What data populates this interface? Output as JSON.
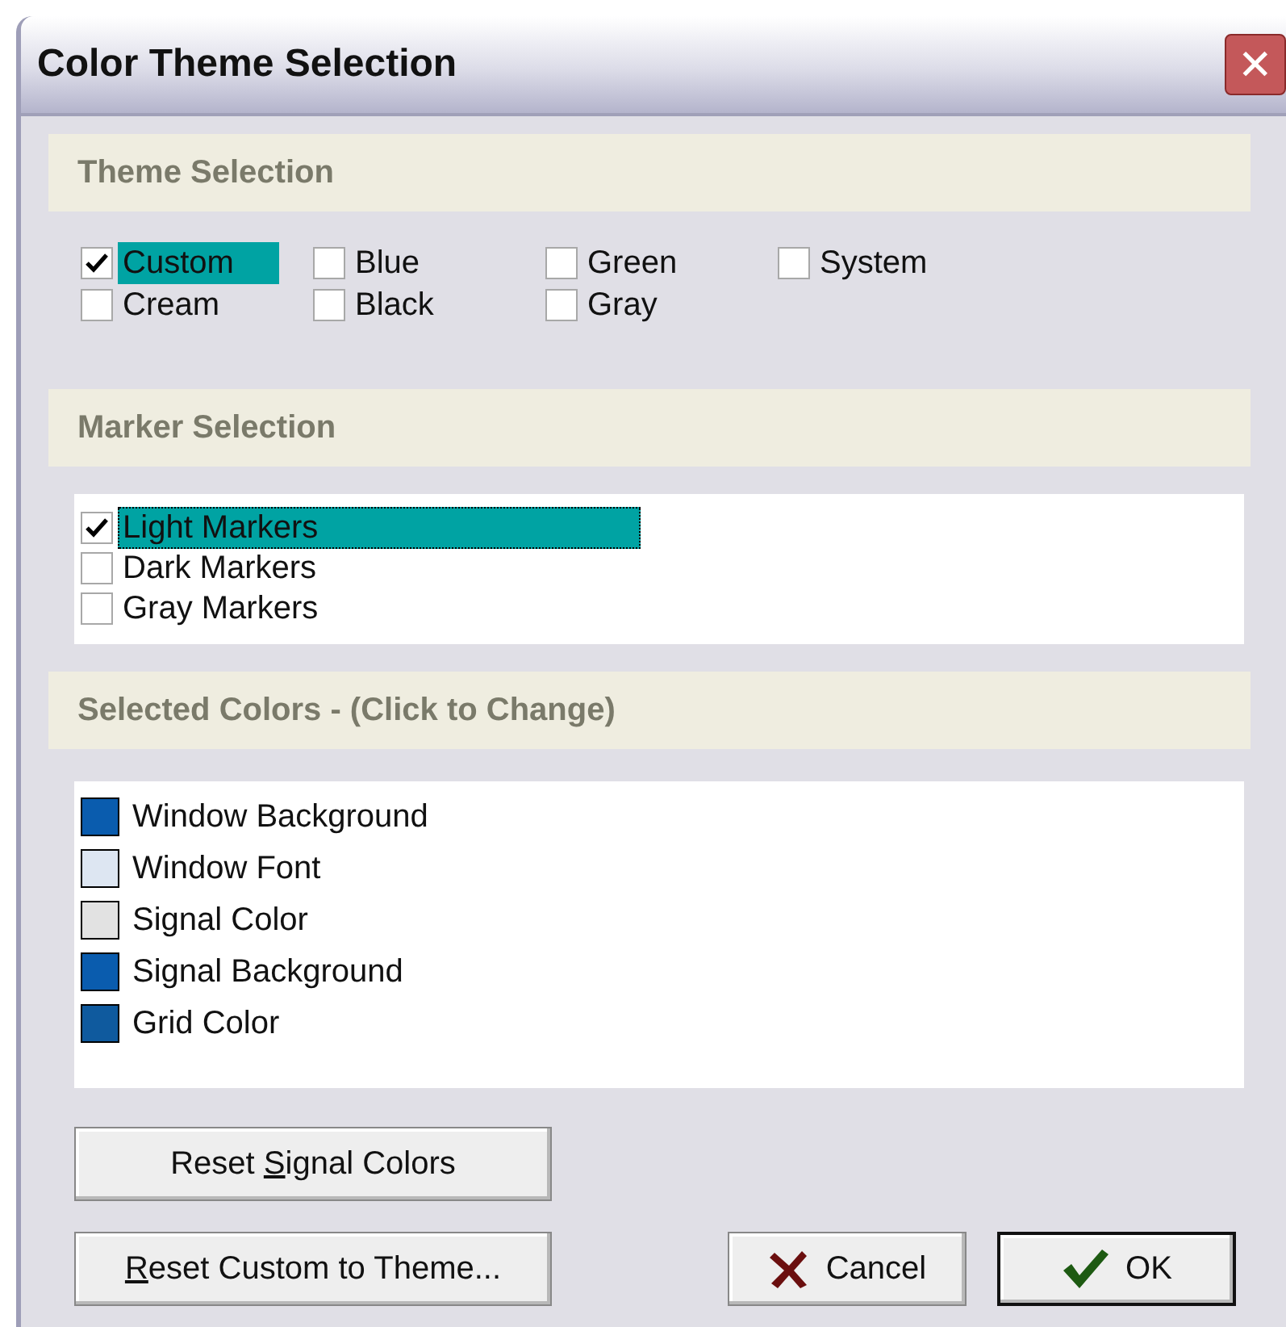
{
  "window": {
    "title": "Color Theme Selection",
    "close": "✕"
  },
  "theme_section": {
    "heading": "Theme Selection",
    "options": [
      {
        "label": "Custom",
        "checked": true,
        "selected": true
      },
      {
        "label": "Cream",
        "checked": false,
        "selected": false
      },
      {
        "label": "Blue",
        "checked": false,
        "selected": false
      },
      {
        "label": "Black",
        "checked": false,
        "selected": false
      },
      {
        "label": "Green",
        "checked": false,
        "selected": false
      },
      {
        "label": "Gray",
        "checked": false,
        "selected": false
      },
      {
        "label": "System",
        "checked": false,
        "selected": false
      }
    ]
  },
  "marker_section": {
    "heading": "Marker Selection",
    "options": [
      {
        "label": "Light Markers",
        "checked": true,
        "selected": true
      },
      {
        "label": "Dark Markers",
        "checked": false,
        "selected": false
      },
      {
        "label": "Gray Markers",
        "checked": false,
        "selected": false
      }
    ]
  },
  "colors_section": {
    "heading": "Selected Colors - (Click to Change)",
    "items": [
      {
        "label": "Window Background",
        "color": "#0a5cae"
      },
      {
        "label": "Window Font",
        "color": "#dde6f2"
      },
      {
        "label": "Signal Color",
        "color": "#e2e2e2"
      },
      {
        "label": "Signal Background",
        "color": "#0a5cae"
      },
      {
        "label": "Grid Color",
        "color": "#0f5a9e"
      }
    ]
  },
  "buttons": [
    {
      "label_before": "Reset ",
      "access_key": "S",
      "label_after": "ignal Colors",
      "kind": "plain"
    },
    {
      "access_key": "R",
      "label_after": "eset Custom to Theme...",
      "kind": "plain"
    },
    {
      "label": "Cancel",
      "kind": "cancel"
    },
    {
      "label": "OK",
      "kind": "ok"
    }
  ]
}
